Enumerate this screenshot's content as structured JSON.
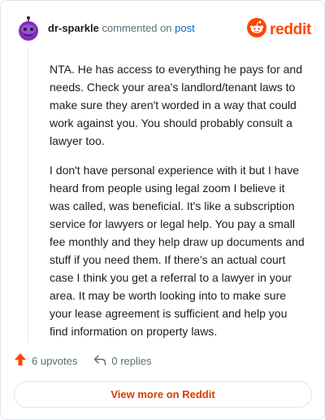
{
  "header": {
    "username": "dr-sparkle",
    "verb": "commented on",
    "post_link": "post",
    "brand": "reddit"
  },
  "comment": {
    "paragraphs": [
      "NTA. He has access to everything he pays for and needs. Check your area's landlord/tenant laws to make sure they aren't worded in a way that could work against you. You should probably consult a lawyer too.",
      "I don't have personal experience with it but I have heard from people using legal zoom I believe it was called, was beneficial. It's like a subscription service for lawyers or legal help. You pay a small fee monthly and they help draw up documents and stuff if you need them. If there's an actual court case I think you get a referral to a lawyer in your area. It may be worth looking into to make sure your lease agreement is sufficient and help you find information on property laws."
    ]
  },
  "actions": {
    "upvotes": "6 upvotes",
    "replies": "0 replies"
  },
  "footer": {
    "view_more": "View more on Reddit"
  },
  "colors": {
    "accent": "#ff4500",
    "link": "#0a66c2",
    "view_more": "#d93a00",
    "avatar": "#7b2fb8"
  },
  "icons": {
    "avatar": "snoo-avatar-icon",
    "logo": "reddit-logo-icon",
    "upvote": "upvote-arrow-icon",
    "reply": "reply-arrow-icon"
  }
}
